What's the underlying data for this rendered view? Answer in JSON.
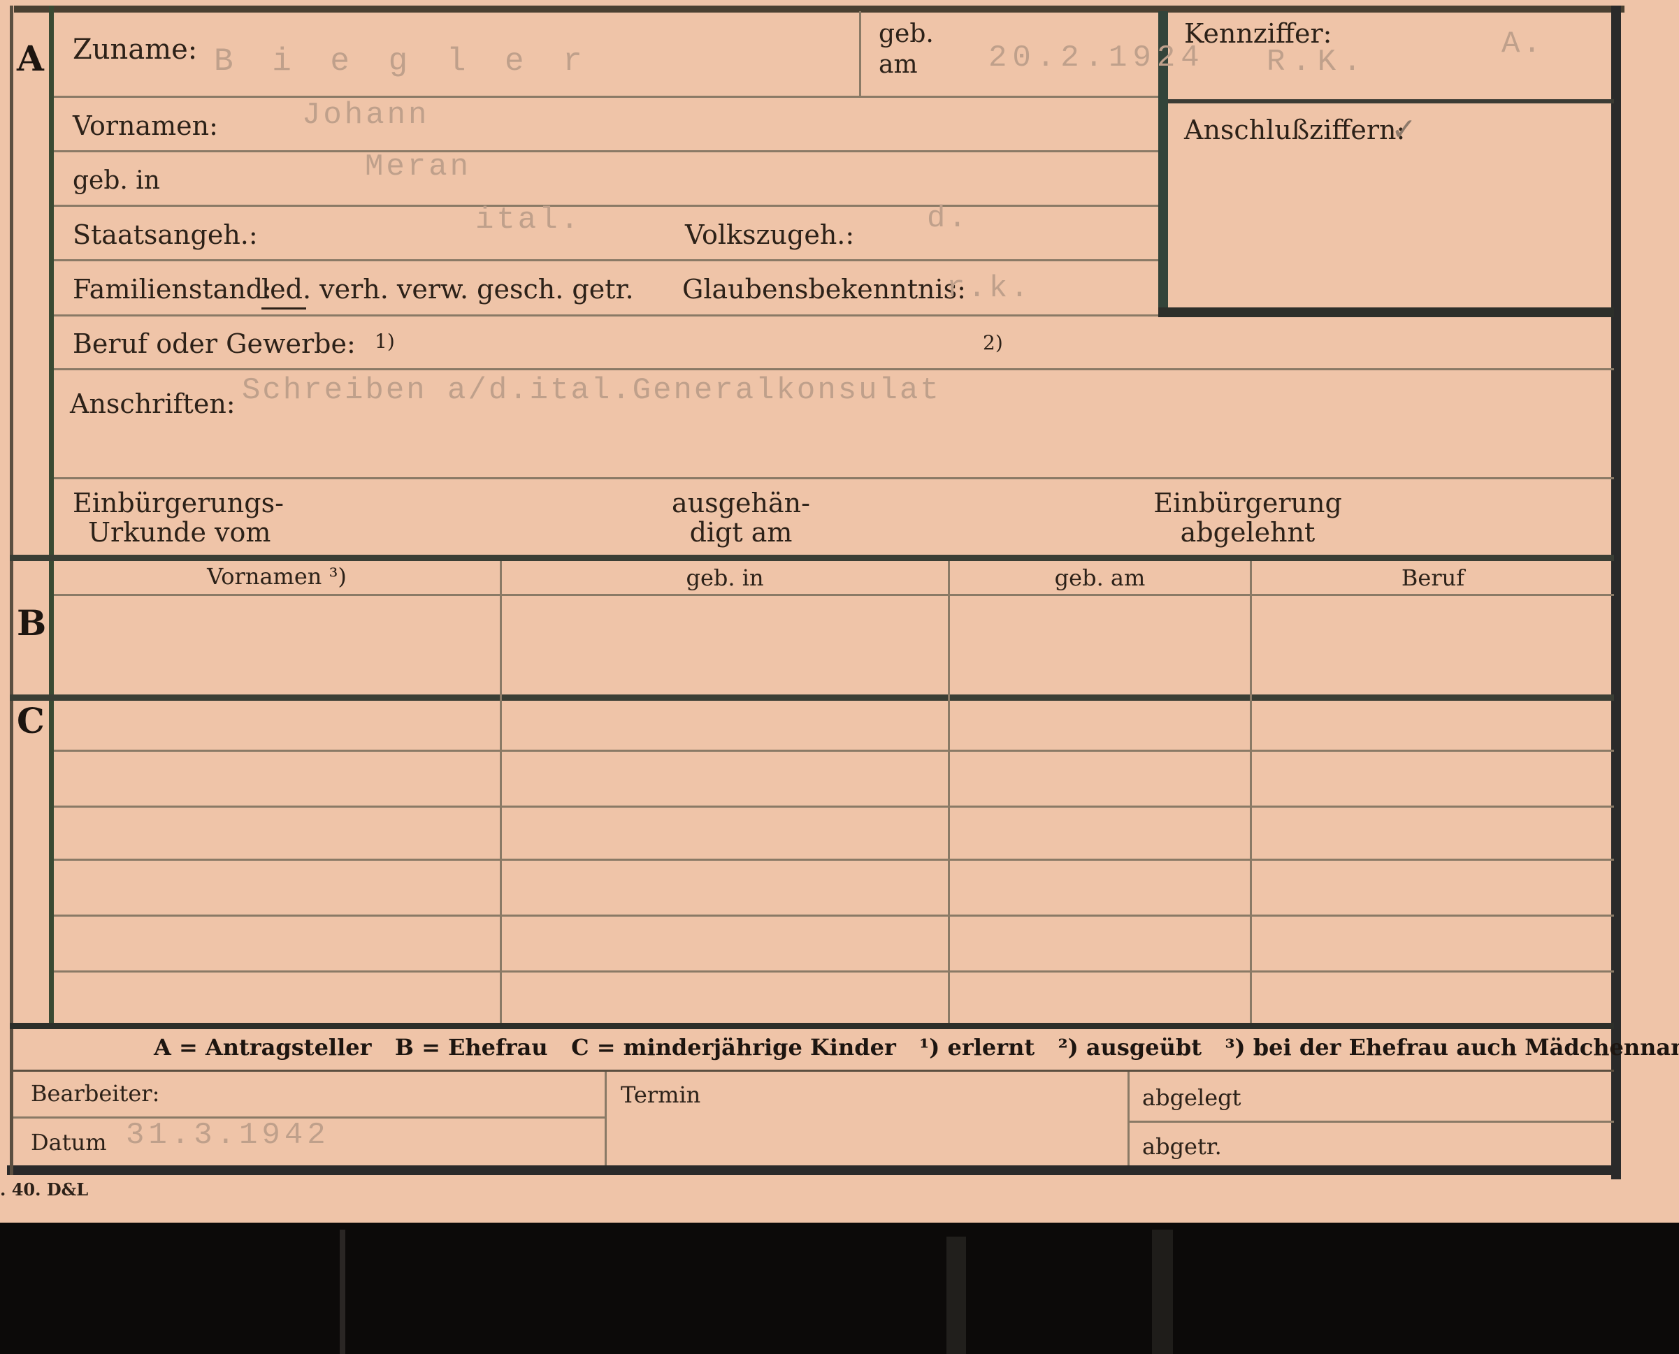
{
  "section_a": {
    "letter": "A",
    "zuname_label": "Zuname:",
    "zuname_value": "B i e g l e r",
    "geb_label_1": "geb.",
    "geb_label_2": "am",
    "geb_value": "20.2.1924",
    "kennziffer_label": "Kennziffer:",
    "kennziffer_value_1": "R.K.",
    "kennziffer_value_2": "A.",
    "anschluss_label": "Anschlußziffern:",
    "anschluss_mark": "✓",
    "vornamen_label": "Vornamen:",
    "vornamen_value": "Johann",
    "gebin_label": "geb. in",
    "gebin_value": "Meran",
    "staat_label": "Staatsangeh.:",
    "staat_value": "ital.",
    "volk_label": "Volkszugeh.:",
    "volk_value": "d.",
    "familien_label": "Familienstand:",
    "familien_options": "led. verh. verw. gesch. getr.",
    "glauben_label": "Glaubensbekenntnis:",
    "glauben_value": "r.k.",
    "beruf_label": "Beruf oder Gewerbe:",
    "beruf_note1": "1)",
    "beruf_note2": "2)",
    "anschriften_label": "Anschriften:",
    "anschriften_value": "Schreiben a/d.ital.Generalkonsulat",
    "einb_urkunde_1": "Einbürgerungs-",
    "einb_urkunde_2": "Urkunde vom",
    "ausgehaendigt_1": "ausgehän-",
    "ausgehaendigt_2": "digt am",
    "einb_abgelehnt_1": "Einbürgerung",
    "einb_abgelehnt_2": "abgelehnt"
  },
  "section_b": {
    "letter": "B",
    "columns": [
      "Vornamen ³)",
      "geb. in",
      "geb. am",
      "Beruf"
    ]
  },
  "section_c": {
    "letter": "C"
  },
  "legend": "A = Antragsteller   B = Ehefrau   C = minderjährige Kinder   ¹) erlernt   ²) ausgeübt   ³) bei der Ehefrau auch Mädchenname",
  "bottom": {
    "bearbeiter_label": "Bearbeiter:",
    "datum_label": "Datum",
    "datum_value": "31.3.1942",
    "termin_label": "Termin",
    "abgelegt_label": "abgelegt",
    "abgetr_label": "abgetr."
  },
  "imprint": ". 40. D&L"
}
